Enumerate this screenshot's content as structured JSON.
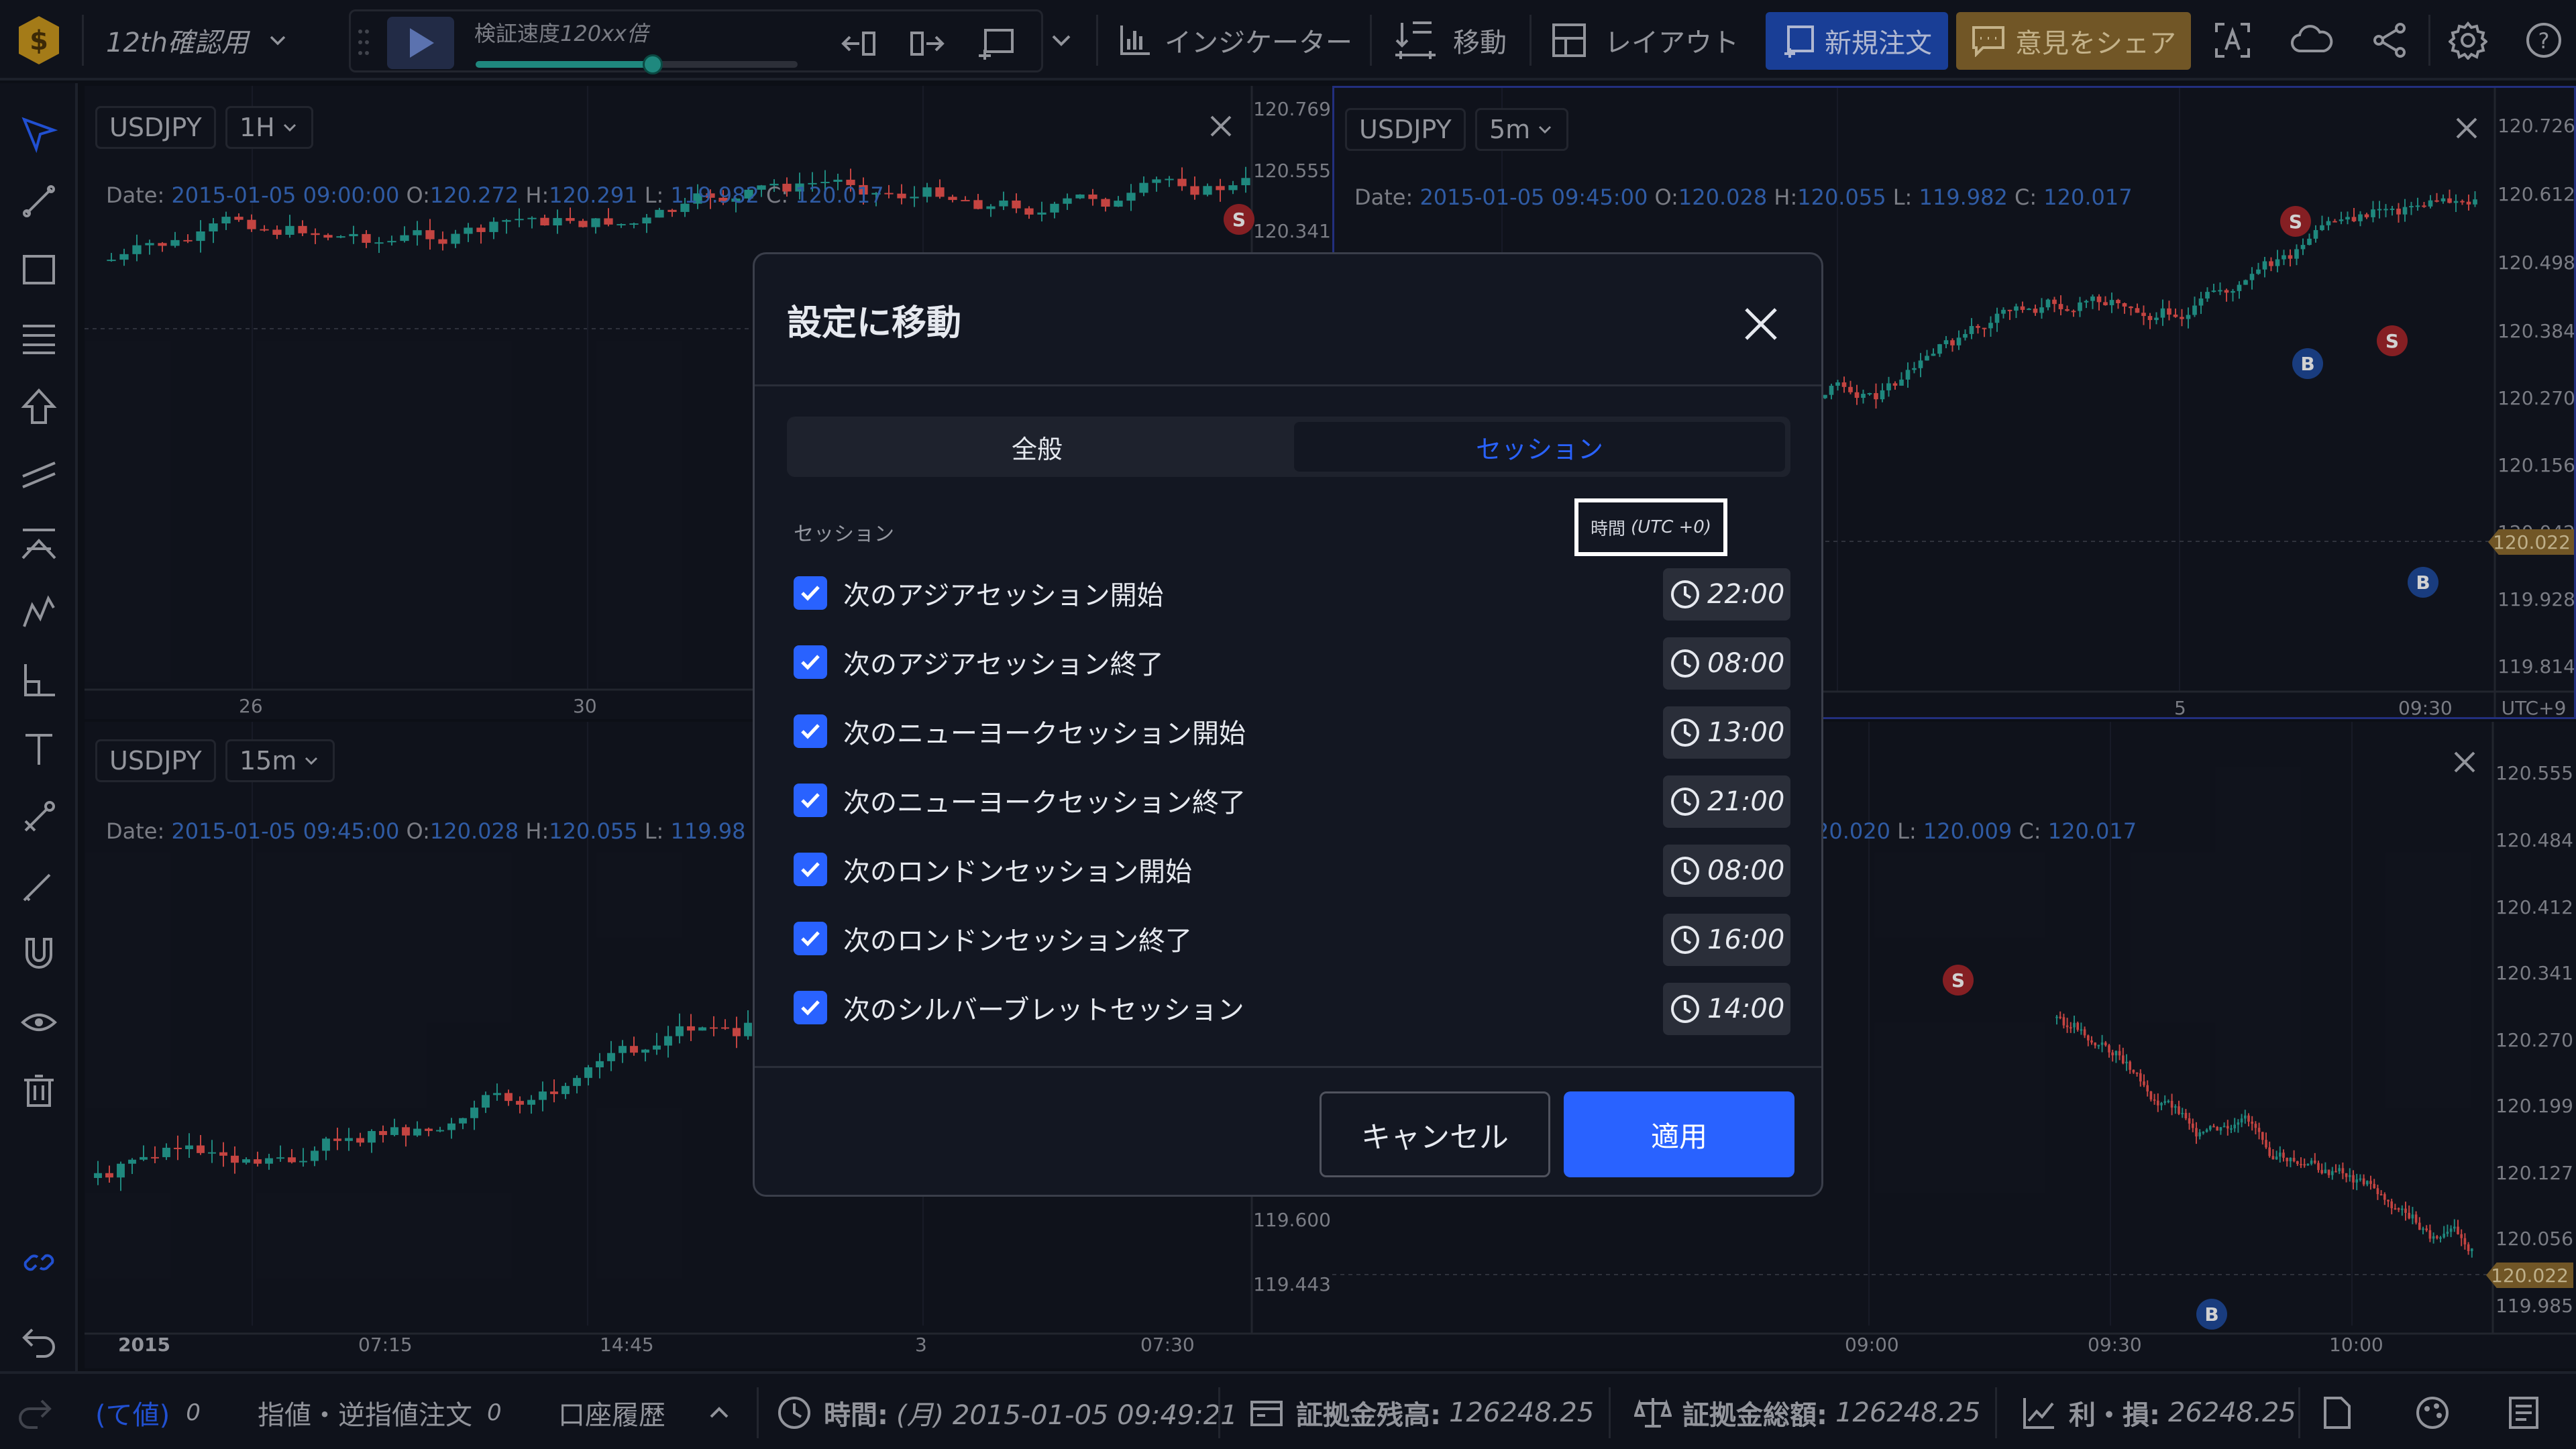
{
  "app": {
    "workspace_name": "12th確認用",
    "speed_label": "検証速度",
    "speed_value": "120xx倍",
    "speed_progress": 0.55
  },
  "toolbar": {
    "indicators": "インジケーター",
    "move": "移動",
    "layout": "レイアウト",
    "new_order": "新規注文",
    "share_opinion": "意見をシェア"
  },
  "charts": [
    {
      "symbol": "USDJPY",
      "timeframe": "1H",
      "ohlc": {
        "date_label": "Date:",
        "date": "2015-01-05 09:00:00",
        "o_label": "O:",
        "o": "120.272",
        "h_label": "H:",
        "h": "120.291",
        "l_label": "L:",
        "l": "119.982",
        "c_label": "C:",
        "c": "120.017"
      },
      "yaxis": [
        "120.769",
        "120.555",
        "120.341"
      ],
      "xaxis": [
        "26",
        "30"
      ]
    },
    {
      "symbol": "USDJPY",
      "timeframe": "5m",
      "ohlc": {
        "date_label": "Date:",
        "date": "2015-01-05 09:45:00",
        "o_label": "O:",
        "o": "120.028",
        "h_label": "H:",
        "h": "120.055",
        "l_label": "L:",
        "l": "119.982",
        "c_label": "C:",
        "c": "120.017"
      },
      "yaxis": [
        "120.726",
        "120.612",
        "120.498",
        "120.384",
        "120.270",
        "120.156",
        "120.042",
        "119.928",
        "119.814"
      ],
      "price_tag": "120.022",
      "xaxis": [
        "5",
        "09:30"
      ],
      "timezone": "UTC+9"
    },
    {
      "symbol": "USDJPY",
      "timeframe": "15m",
      "ohlc": {
        "date_label": "Date:",
        "date": "2015-01-05 09:45:00",
        "o_label": "O:",
        "o": "120.028",
        "h_label": "H:",
        "h": "120.055",
        "l_label": "L:",
        "l": "119.98"
      },
      "yaxis": [
        "119.600",
        "119.443"
      ],
      "xaxis": [
        "2015",
        "07:15",
        "14:45",
        "3",
        "07:30"
      ]
    },
    {
      "ohlc": {
        "o": "20.020",
        "l_label": "L:",
        "l": "120.009",
        "c_label": "C:",
        "c": "120.017"
      },
      "yaxis": [
        "120.555",
        "120.484",
        "120.412",
        "120.341",
        "120.270",
        "120.199",
        "120.127",
        "120.056",
        "119.985"
      ],
      "price_tag": "120.022",
      "xaxis": [
        "09:00",
        "09:30",
        "10:00"
      ]
    }
  ],
  "markers": {
    "sell": "S",
    "buy": "B"
  },
  "bottombar": {
    "tab_cut": "(て値)",
    "tab_cut_count": "0",
    "orders_tab": "指値・逆指値注文",
    "orders_count": "0",
    "history_tab": "口座履歴",
    "time_label": "時間:",
    "time_value": "(月) 2015-01-05 09:49:21",
    "margin_balance_label": "証拠金残高:",
    "margin_balance_value": "126248.25",
    "margin_total_label": "証拠金総額:",
    "margin_total_value": "126248.25",
    "pnl_label": "利・損:",
    "pnl_value": "26248.25"
  },
  "dialog": {
    "title": "設定に移動",
    "tabs": [
      "全般",
      "セッション"
    ],
    "active_tab": "セッション",
    "section_label": "セッション",
    "time_header": "時間",
    "time_zone": "(UTC +0)",
    "rows": [
      {
        "label": "次のアジアセッション開始",
        "time": "22:00",
        "checked": true
      },
      {
        "label": "次のアジアセッション終了",
        "time": "08:00",
        "checked": true
      },
      {
        "label": "次のニューヨークセッション開始",
        "time": "13:00",
        "checked": true
      },
      {
        "label": "次のニューヨークセッション終了",
        "time": "21:00",
        "checked": true
      },
      {
        "label": "次のロンドンセッション開始",
        "time": "08:00",
        "checked": true
      },
      {
        "label": "次のロンドンセッション終了",
        "time": "16:00",
        "checked": true
      },
      {
        "label": "次のシルバーブレットセッション",
        "time": "14:00",
        "checked": true
      }
    ],
    "cancel": "キャンセル",
    "apply": "適用"
  },
  "colors": {
    "accent": "#2962ff",
    "up": "#26a69a",
    "down": "#ef5350",
    "background": "#131722"
  }
}
